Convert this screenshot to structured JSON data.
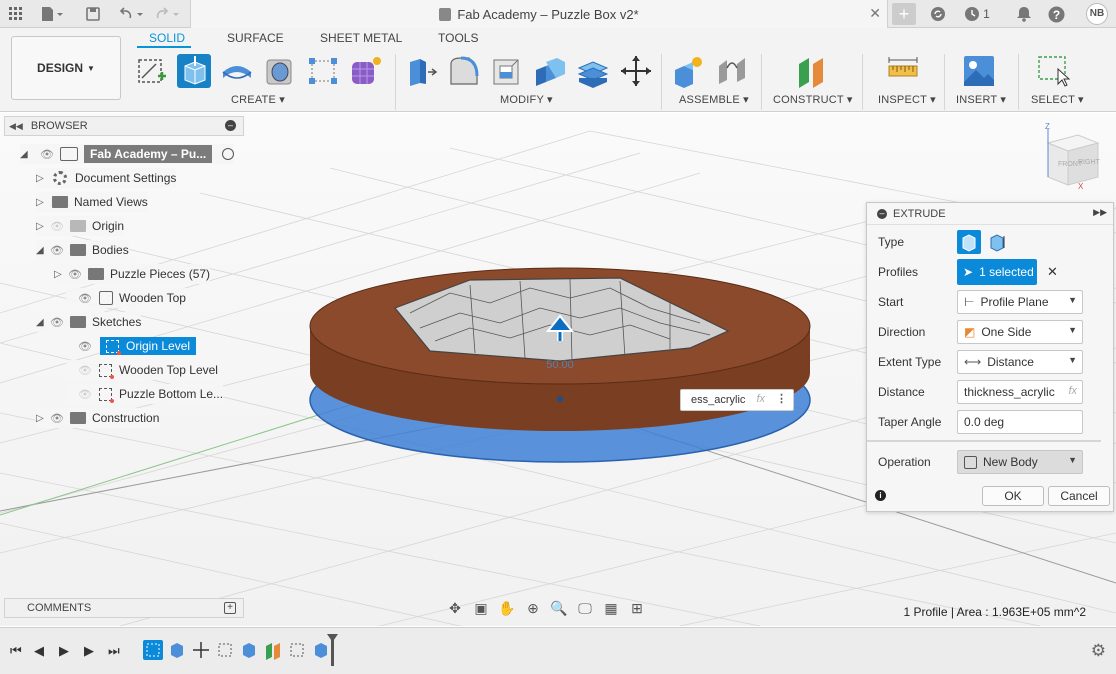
{
  "titlebar": {
    "doc_title": "Fab Academy – Puzzle Box v2*",
    "jobs_count": "1",
    "user_initials": "NB",
    "icons": [
      "grid-icon",
      "file-icon",
      "save-icon",
      "undo-icon",
      "redo-icon",
      "close-icon",
      "plus-icon",
      "sync-icon",
      "clock-icon",
      "bell-icon",
      "help-icon"
    ]
  },
  "toolbar": {
    "workspace": "DESIGN",
    "tabs": [
      "SOLID",
      "SURFACE",
      "SHEET METAL",
      "TOOLS"
    ],
    "active_tab": "SOLID",
    "groups": [
      "CREATE",
      "MODIFY",
      "ASSEMBLE",
      "CONSTRUCT",
      "INSPECT",
      "INSERT",
      "SELECT"
    ]
  },
  "browser": {
    "title": "BROWSER",
    "root": "Fab Academy – Pu...",
    "items": [
      {
        "label": "Document Settings"
      },
      {
        "label": "Named Views"
      },
      {
        "label": "Origin"
      },
      {
        "label": "Bodies"
      },
      {
        "label": "Puzzle Pieces (57)"
      },
      {
        "label": "Wooden Top"
      },
      {
        "label": "Sketches"
      },
      {
        "label": "Origin Level"
      },
      {
        "label": "Wooden Top Level"
      },
      {
        "label": "Puzzle Bottom Le..."
      },
      {
        "label": "Construction"
      }
    ]
  },
  "comments": {
    "title": "COMMENTS"
  },
  "viewport": {
    "measure_label": "50.00",
    "distance_input": "ess_acrylic",
    "fx": "fx",
    "viewcube_faces": [
      "FRONT",
      "RIGHT"
    ],
    "axis_z": "Z",
    "axis_x": "X"
  },
  "extrude": {
    "title": "EXTRUDE",
    "labels": {
      "type": "Type",
      "profiles": "Profiles",
      "start": "Start",
      "direction": "Direction",
      "extent_type": "Extent Type",
      "distance": "Distance",
      "taper_angle": "Taper Angle",
      "operation": "Operation"
    },
    "values": {
      "profiles": "1 selected",
      "start": "Profile Plane",
      "direction": "One Side",
      "extent_type": "Distance",
      "distance": "thickness_acrylic",
      "taper_angle": "0.0 deg",
      "operation": "New Body"
    },
    "fx": "fx",
    "ok": "OK",
    "cancel": "Cancel"
  },
  "status": {
    "text": "1 Profile | Area : 1.963E+05 mm^2"
  },
  "colors": {
    "accent": "#0696d7",
    "selection": "#0a8ad8",
    "wood": "#8b4a2b",
    "plane": "#3d7fd6"
  }
}
